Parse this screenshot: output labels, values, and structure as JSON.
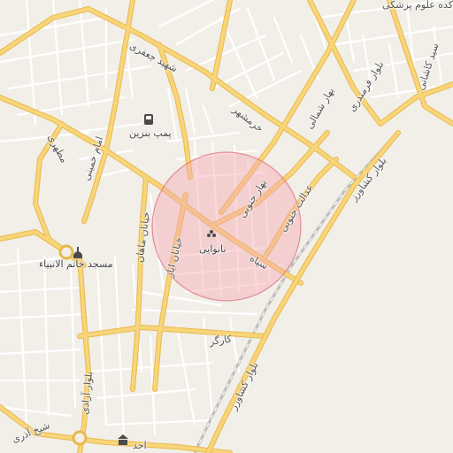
{
  "map": {
    "colors": {
      "background": "#f2efe9",
      "minor_road": "#ffffff",
      "major_road": "#f8d57a",
      "major_road_casing": "#e8b94c",
      "railway": "#c8c8c8",
      "circle_fill": "#f3a9b0",
      "circle_stroke": "#e06b7a"
    },
    "labels": {
      "top_right": "کده علوم پزشکی",
      "shahid_jafari": "شهید جعفری",
      "motahari": "مطهری",
      "gas_station": "پمپ بنزین",
      "imam_khomeini": "امام خمینی",
      "khorramshahr": "خرمشهر",
      "bahar_shomali": "بهار شمالی",
      "bolvar_farmandari": "بلوار فرمندری",
      "kashani": "سید کاشانی",
      "bolvar_keshavarz_top": "بلوار کشاورز",
      "bahar_jonubi": "بهار جنوبی",
      "edalat_jonubi": "عدالت جنوبی",
      "khiaban_mahan": "خیابان ماهان",
      "khiaban_ayaz": "خیابان ایاز",
      "nanvaei": "نانوایی",
      "sepah": "سپاه",
      "masjed": "مسجد خاتم الانبیاء",
      "kargar": "کارگر",
      "bolvar_azadi": "بلوار آزادی",
      "sheikh_azari": "شیخ آذری",
      "bolvar_keshavarz_bottom": "بلوار کشاورز",
      "bottom_label": "احد"
    },
    "icons": {
      "gas_station": "gas-pump-icon",
      "bakery": "bakery-icon",
      "mosque": "mosque-icon",
      "museum": "museum-icon"
    }
  }
}
